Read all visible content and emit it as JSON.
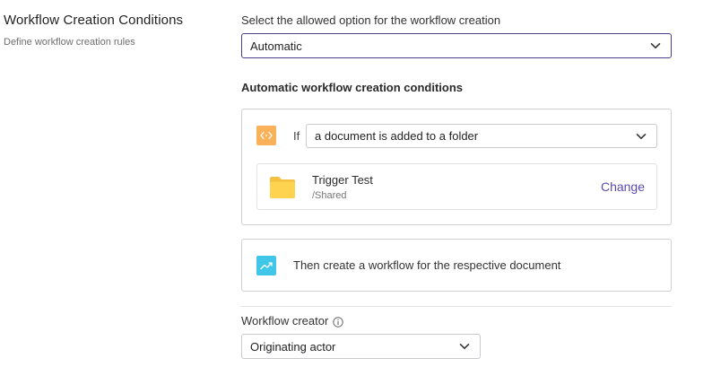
{
  "section": {
    "title": "Workflow Creation Conditions",
    "description": "Define workflow creation rules"
  },
  "creation_option": {
    "label": "Select the allowed option for the workflow creation",
    "value": "Automatic"
  },
  "conditions": {
    "heading": "Automatic workflow creation conditions",
    "if_label": "If",
    "trigger_value": "a document is added to a folder",
    "folder": {
      "name": "Trigger Test",
      "path": "/Shared",
      "change_label": "Change"
    },
    "action_text": "Then create a workflow for the respective document"
  },
  "creator": {
    "label": "Workflow creator",
    "value": "Originating actor"
  },
  "colors": {
    "trigger_icon_bg": "#f9b15a",
    "action_icon_bg": "#3fc6e8",
    "folder": "#fdd34f",
    "link": "#5b4bb0",
    "focus_border": "#4a3f8f"
  },
  "icons": {
    "trigger": "code-arrows-icon",
    "action": "trend-up-icon",
    "folder": "folder-icon",
    "info": "info-icon",
    "dropdown": "chevron-down-icon"
  }
}
